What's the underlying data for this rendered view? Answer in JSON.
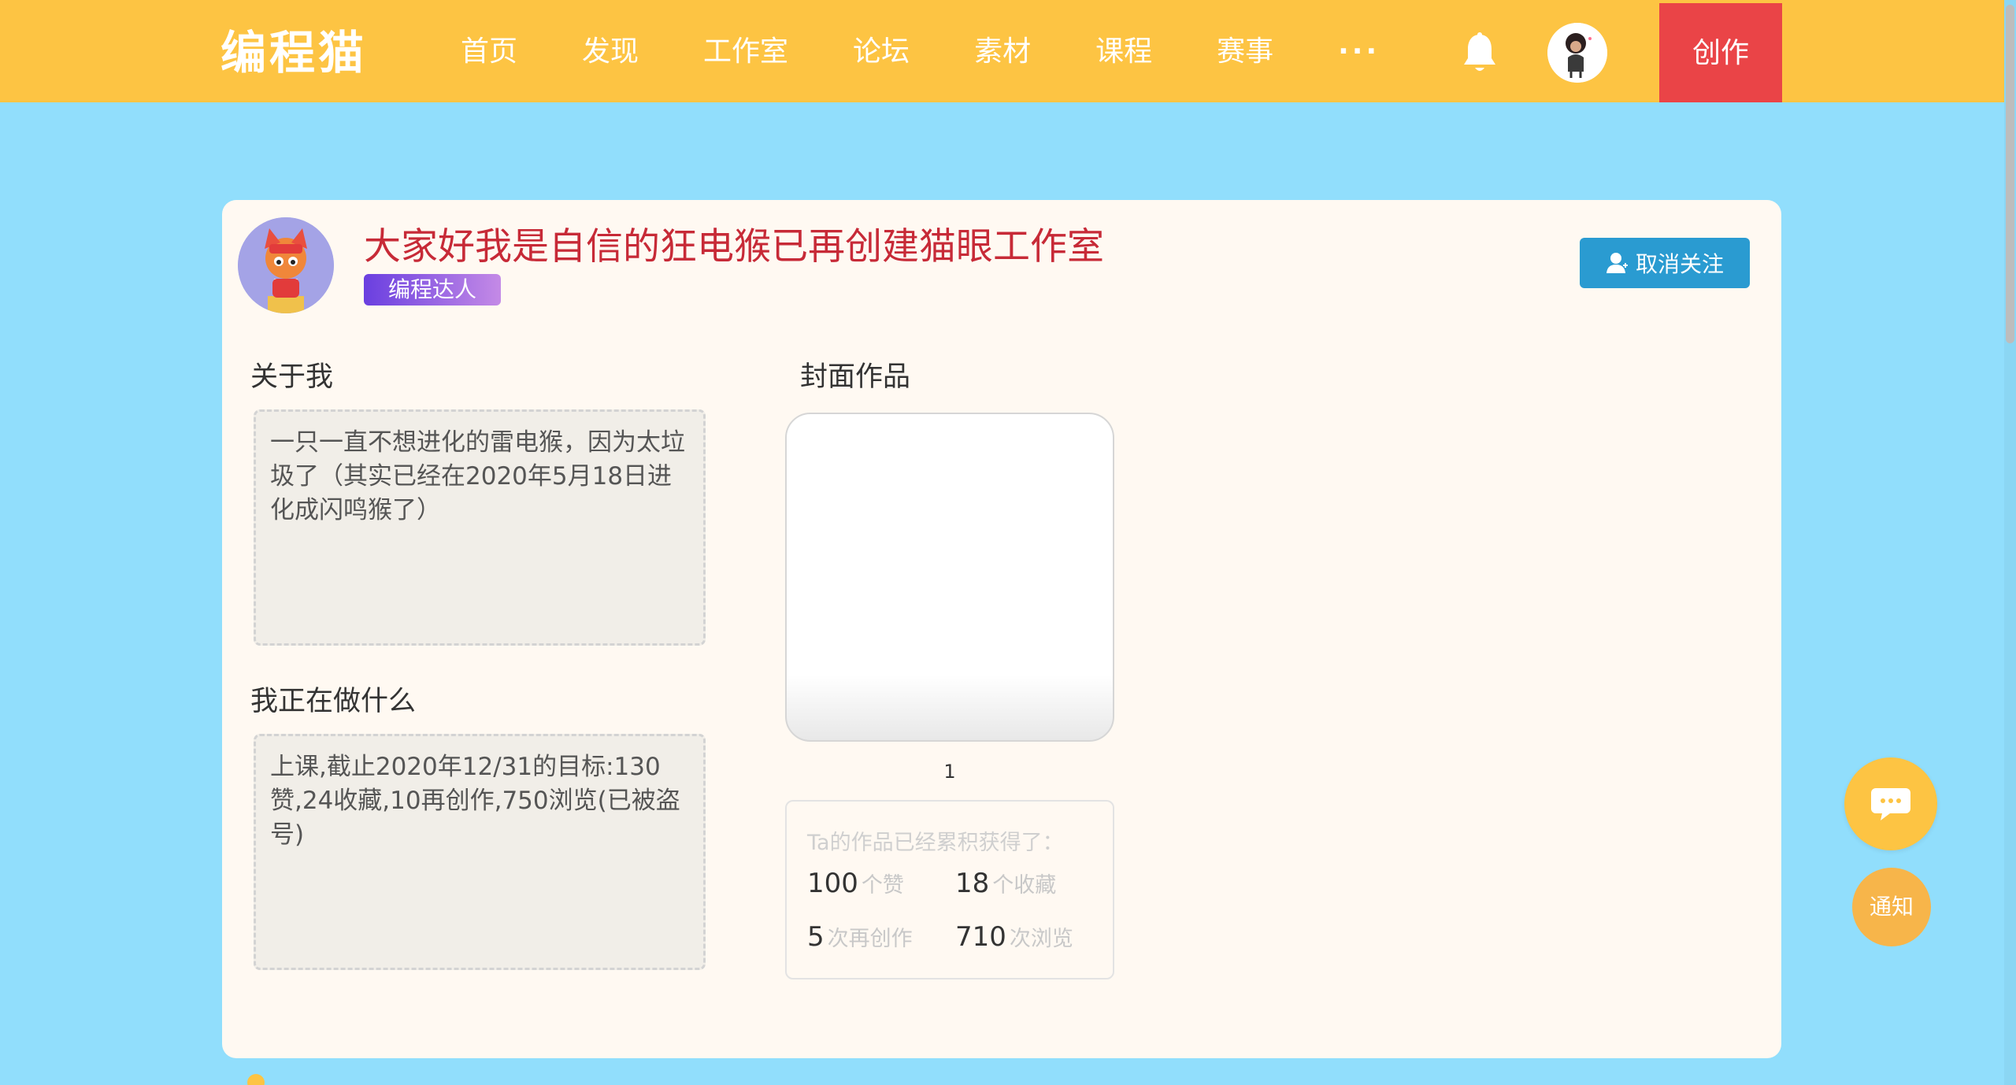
{
  "topbar": {
    "logo": "编程猫",
    "nav": [
      "首页",
      "发现",
      "工作室",
      "论坛",
      "素材",
      "课程",
      "赛事",
      "···"
    ],
    "create_label": "创作",
    "bell_icon": "bell-icon",
    "accent": "#fdc443",
    "create_color": "#ea4447"
  },
  "profile": {
    "title": "大家好我是自信的狂电猴已再创建猫眼工作室",
    "badge": "编程达人",
    "follow_label": "取消关注"
  },
  "about": {
    "heading": "关于我",
    "text": "一只一直不想进化的雷电猴，因为太垃圾了（其实已经在2020年5月18日进化成闪鸣猴了）"
  },
  "doing": {
    "heading": "我正在做什么",
    "text": "上课,截止2020年12/31的目标:130赞,24收藏,10再创作,750浏览(已被盗号)"
  },
  "cover": {
    "heading": "封面作品",
    "index": "1"
  },
  "stats": {
    "heading": "Ta的作品已经累积获得了：",
    "likes": {
      "num": "100",
      "unit": "个赞"
    },
    "favorites": {
      "num": "18",
      "unit": "个收藏"
    },
    "remixes": {
      "num": "5",
      "unit": "次再创作"
    },
    "views": {
      "num": "710",
      "unit": "次浏览"
    }
  },
  "fab": {
    "chat_icon": "chat-bubble-icon",
    "notice_label": "通知"
  }
}
